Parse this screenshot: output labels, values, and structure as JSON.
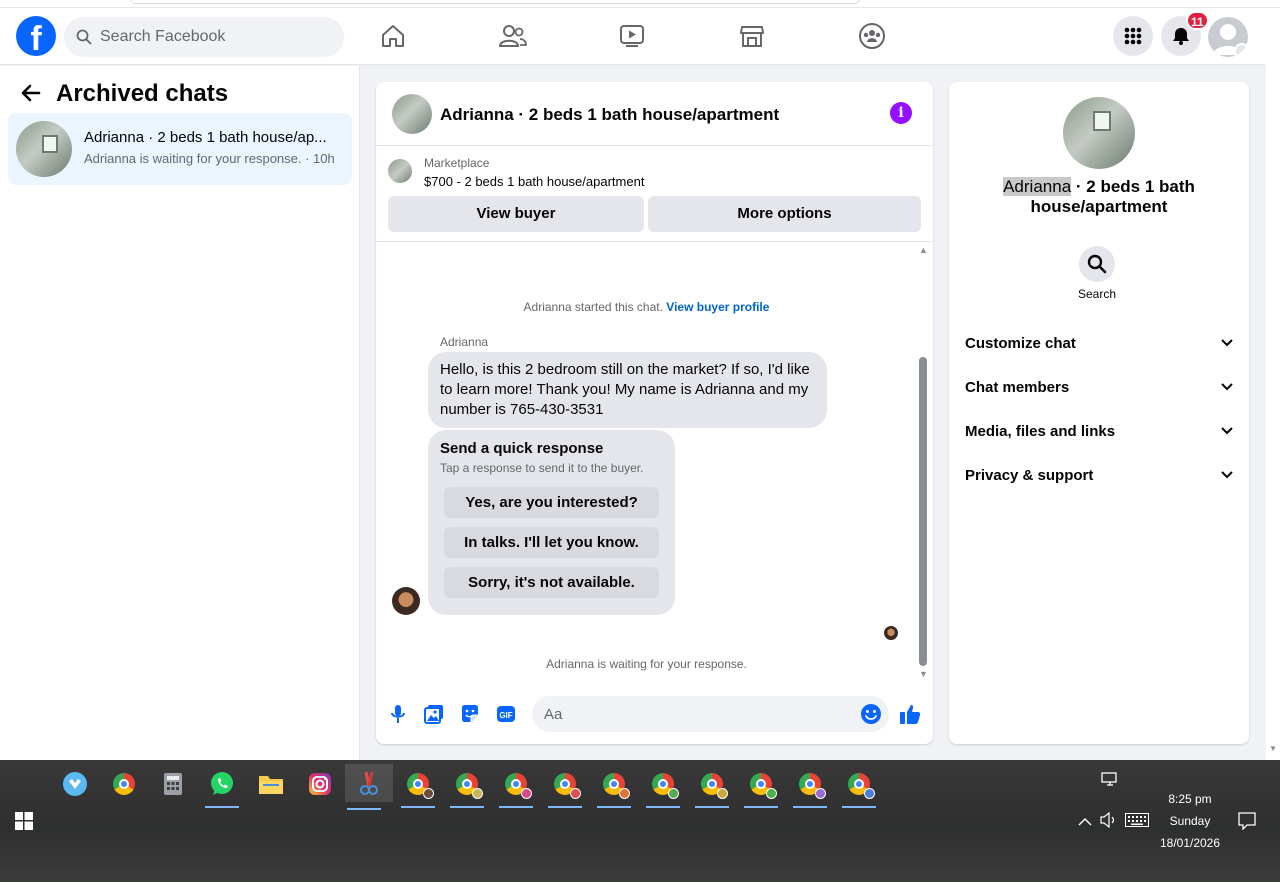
{
  "header": {
    "search_placeholder": "Search Facebook",
    "notification_count": "11",
    "nav": [
      "home-icon",
      "friends-icon",
      "video-icon",
      "marketplace-icon",
      "groups-icon"
    ],
    "brand_color": "#0866ff"
  },
  "left": {
    "title": "Archived chats",
    "chats": [
      {
        "name": "Adrianna · 2 beds 1 bath house/ap...",
        "preview": "Adrianna is waiting for your response. · 10h"
      }
    ]
  },
  "chat": {
    "title": "Adrianna · 2 beds 1 bath house/apartment",
    "marketplace_label": "Marketplace",
    "listing": "$700 - 2 beds 1 bath house/apartment",
    "view_buyer": "View buyer",
    "more_options": "More options",
    "started_text": "Adrianna started this chat.",
    "buyer_profile_link": "View buyer profile",
    "sender": "Adrianna",
    "message": "Hello, is this 2 bedroom still on the market? If so, I'd like to learn more! Thank you! My name is Adrianna and my number is 765-430-3531",
    "quick_title": "Send a quick response",
    "quick_sub": "Tap a response to send it to the buyer.",
    "quick_responses": [
      "Yes, are you interested?",
      "In talks. I'll let you know.",
      "Sorry, it's not available."
    ],
    "waiting": "Adrianna is waiting for your response.",
    "input_placeholder": "Aa",
    "accent_color": "#0866ff"
  },
  "right": {
    "name_highlight": "Adrianna",
    "name_rest": " · 2 beds 1 bath house/apartment",
    "search_label": "Search",
    "sections": [
      "Customize chat",
      "Chat members",
      "Media, files and links",
      "Privacy & support"
    ]
  },
  "taskbar": {
    "time": "8:25 pm",
    "day": "Sunday",
    "date": "18/01/2026"
  }
}
